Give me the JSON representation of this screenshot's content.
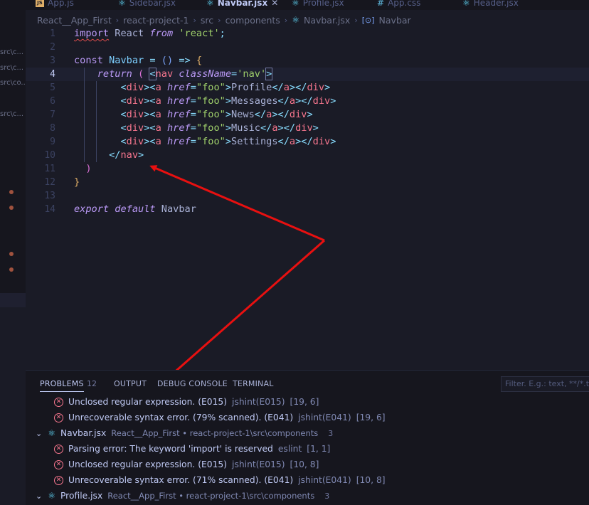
{
  "side": {
    "paths": [
      "src\\c...",
      "src\\c...",
      "src\\co...",
      "src\\c..."
    ]
  },
  "tabs": [
    {
      "label": "App.js",
      "icon": "js-icon"
    },
    {
      "label": "Sidebar.jsx",
      "icon": "react-icon"
    },
    {
      "label": "Navbar.jsx",
      "icon": "react-icon",
      "active": true
    },
    {
      "label": "Profile.jsx",
      "icon": "react-icon"
    },
    {
      "label": "App.css",
      "icon": "css-icon"
    },
    {
      "label": "Header.jsx",
      "icon": "react-icon"
    }
  ],
  "breadcrumb": {
    "items": [
      "React__App_First",
      "react-project-1",
      "src",
      "components",
      "Navbar.jsx",
      "Navbar"
    ]
  },
  "editor": {
    "current_line": 4,
    "lines": [
      {
        "n": "1",
        "tokens": [
          [
            "import",
            "kw squig"
          ],
          [
            " React ",
            "plain"
          ],
          [
            "from",
            "kwi"
          ],
          [
            " ",
            "plain"
          ],
          [
            "'react'",
            "str"
          ],
          [
            ";",
            "pun"
          ]
        ]
      },
      {
        "n": "2",
        "tokens": []
      },
      {
        "n": "3",
        "tokens": [
          [
            "const",
            "kw"
          ],
          [
            " ",
            "plain"
          ],
          [
            "Navbar",
            "id"
          ],
          [
            " = ",
            "op"
          ],
          [
            "()",
            "brk"
          ],
          [
            " => ",
            "op"
          ],
          [
            "{",
            "brace"
          ]
        ]
      },
      {
        "n": "4",
        "tokens": [
          [
            "    ",
            "plain"
          ],
          [
            "return",
            "kwi"
          ],
          [
            " ",
            "plain"
          ],
          [
            "(",
            "paren"
          ],
          [
            " ",
            "plain"
          ],
          [
            "<",
            "pun hl-bracket"
          ],
          [
            "nav",
            "tag"
          ],
          [
            " ",
            "plain"
          ],
          [
            "className",
            "attr"
          ],
          [
            "=",
            "op"
          ],
          [
            "'nav'",
            "str"
          ],
          [
            ">",
            "pun hl-bracket"
          ]
        ]
      },
      {
        "n": "5",
        "tokens": [
          [
            "        ",
            "plain"
          ],
          [
            "<",
            "pun"
          ],
          [
            "div",
            "tag"
          ],
          [
            "><",
            "pun"
          ],
          [
            "a",
            "tag"
          ],
          [
            " ",
            "plain"
          ],
          [
            "href",
            "attr"
          ],
          [
            "=",
            "op"
          ],
          [
            "\"foo\"",
            "str"
          ],
          [
            ">",
            "pun"
          ],
          [
            "Profile",
            "plain"
          ],
          [
            "</",
            "pun"
          ],
          [
            "a",
            "tag"
          ],
          [
            "></",
            "pun"
          ],
          [
            "div",
            "tag"
          ],
          [
            ">",
            "pun"
          ]
        ]
      },
      {
        "n": "6",
        "tokens": [
          [
            "        ",
            "plain"
          ],
          [
            "<",
            "pun"
          ],
          [
            "div",
            "tag"
          ],
          [
            "><",
            "pun"
          ],
          [
            "a",
            "tag"
          ],
          [
            " ",
            "plain"
          ],
          [
            "href",
            "attr"
          ],
          [
            "=",
            "op"
          ],
          [
            "\"foo\"",
            "str"
          ],
          [
            ">",
            "pun"
          ],
          [
            "Messages",
            "plain"
          ],
          [
            "</",
            "pun"
          ],
          [
            "a",
            "tag"
          ],
          [
            "></",
            "pun"
          ],
          [
            "div",
            "tag"
          ],
          [
            ">",
            "pun"
          ]
        ]
      },
      {
        "n": "7",
        "tokens": [
          [
            "        ",
            "plain"
          ],
          [
            "<",
            "pun"
          ],
          [
            "div",
            "tag"
          ],
          [
            "><",
            "pun"
          ],
          [
            "a",
            "tag"
          ],
          [
            " ",
            "plain"
          ],
          [
            "href",
            "attr"
          ],
          [
            "=",
            "op"
          ],
          [
            "\"foo\"",
            "str"
          ],
          [
            ">",
            "pun"
          ],
          [
            "News",
            "plain"
          ],
          [
            "</",
            "pun"
          ],
          [
            "a",
            "tag"
          ],
          [
            "></",
            "pun"
          ],
          [
            "div",
            "tag"
          ],
          [
            ">",
            "pun"
          ]
        ]
      },
      {
        "n": "8",
        "tokens": [
          [
            "        ",
            "plain"
          ],
          [
            "<",
            "pun"
          ],
          [
            "div",
            "tag"
          ],
          [
            "><",
            "pun"
          ],
          [
            "a",
            "tag"
          ],
          [
            " ",
            "plain"
          ],
          [
            "href",
            "attr"
          ],
          [
            "=",
            "op"
          ],
          [
            "\"foo\"",
            "str"
          ],
          [
            ">",
            "pun"
          ],
          [
            "Music",
            "plain"
          ],
          [
            "</",
            "pun"
          ],
          [
            "a",
            "tag"
          ],
          [
            "></",
            "pun"
          ],
          [
            "div",
            "tag"
          ],
          [
            ">",
            "pun"
          ]
        ]
      },
      {
        "n": "9",
        "tokens": [
          [
            "        ",
            "plain"
          ],
          [
            "<",
            "pun"
          ],
          [
            "div",
            "tag"
          ],
          [
            "><",
            "pun"
          ],
          [
            "a",
            "tag"
          ],
          [
            " ",
            "plain"
          ],
          [
            "href",
            "attr"
          ],
          [
            "=",
            "op"
          ],
          [
            "\"foo\"",
            "str"
          ],
          [
            ">",
            "pun"
          ],
          [
            "Settings",
            "plain"
          ],
          [
            "</",
            "pun"
          ],
          [
            "a",
            "tag"
          ],
          [
            "></",
            "pun"
          ],
          [
            "div",
            "tag"
          ],
          [
            ">",
            "pun"
          ]
        ]
      },
      {
        "n": "10",
        "tokens": [
          [
            "      ",
            "plain"
          ],
          [
            "</",
            "pun"
          ],
          [
            "nav",
            "tag"
          ],
          [
            ">",
            "pun"
          ]
        ]
      },
      {
        "n": "11",
        "tokens": [
          [
            "  ",
            "plain"
          ],
          [
            ")",
            "paren"
          ]
        ]
      },
      {
        "n": "12",
        "tokens": [
          [
            "}",
            "brace"
          ]
        ]
      },
      {
        "n": "13",
        "tokens": []
      },
      {
        "n": "14",
        "tokens": [
          [
            "export",
            "kwi"
          ],
          [
            " ",
            "plain"
          ],
          [
            "default",
            "kwi"
          ],
          [
            " ",
            "plain"
          ],
          [
            "Navbar",
            "plain"
          ]
        ]
      }
    ]
  },
  "panel": {
    "tabs": {
      "problems": "PROBLEMS",
      "problems_count": "12",
      "output": "OUTPUT",
      "debug": "DEBUG CONSOLE",
      "terminal": "TERMINAL"
    },
    "filter_placeholder": "Filter. E.g.: text, **/*.ts, !**/node_modules/**",
    "rows": [
      {
        "kind": "error",
        "msg": "Unclosed regular expression. (E015)",
        "src": "jshint(E015)",
        "pos": "[19, 6]"
      },
      {
        "kind": "error",
        "msg": "Unrecoverable syntax error. (79% scanned). (E041)",
        "src": "jshint(E041)",
        "pos": "[19, 6]"
      },
      {
        "kind": "file",
        "name": "Navbar.jsx",
        "path": "React__App_First • react-project-1\\src\\components",
        "count": "3"
      },
      {
        "kind": "error",
        "msg": "Parsing error: The keyword 'import' is reserved",
        "src": "eslint",
        "pos": "[1, 1]"
      },
      {
        "kind": "error",
        "msg": "Unclosed regular expression. (E015)",
        "src": "jshint(E015)",
        "pos": "[10, 8]"
      },
      {
        "kind": "error",
        "msg": "Unrecoverable syntax error. (71% scanned). (E041)",
        "src": "jshint(E041)",
        "pos": "[10, 8]"
      },
      {
        "kind": "file",
        "name": "Profile.jsx",
        "path": "React__App_First • react-project-1\\src\\components",
        "count": "3"
      }
    ]
  },
  "colors": {
    "annotation_arrow": "#e81010",
    "error": "#f7768e",
    "accent": "#7aa2f7"
  }
}
